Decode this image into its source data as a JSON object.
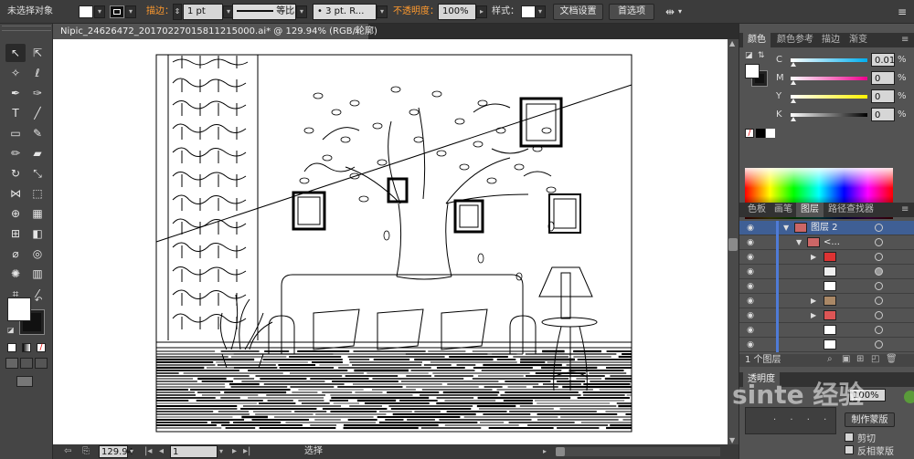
{
  "control_bar": {
    "selection_status": "未选择对象",
    "stroke_label": "描边：",
    "stroke_weight": "1 pt",
    "stroke_profile": "等比",
    "brush": "3 pt. R...",
    "opacity_label": "不透明度：",
    "opacity_value": "100%",
    "style_label": "样式：",
    "doc_setup_button": "文档设置",
    "preferences_button": "首选项"
  },
  "document_tab": {
    "title": "Nipic_24626472_20170227015811215000.ai* @ 129.94% (RGB/轮廓)",
    "close": "×"
  },
  "status_bar": {
    "zoom": "129.94",
    "page": "1",
    "tool_status": "选择"
  },
  "color_panel": {
    "tabs": [
      "颜色",
      "颜色参考",
      "描边",
      "渐变"
    ],
    "channels": [
      {
        "name": "C",
        "value": "0.01",
        "color": "#00aeef"
      },
      {
        "name": "M",
        "value": "0",
        "color": "#ec008c"
      },
      {
        "name": "Y",
        "value": "0",
        "color": "#fff200"
      },
      {
        "name": "K",
        "value": "0",
        "color": "#000000"
      }
    ],
    "percent_sign": "%"
  },
  "layers_panel": {
    "tabs": [
      "色板",
      "画笔",
      "图层",
      "路径查找器"
    ],
    "active_tab": "图层",
    "rows": [
      {
        "name": "图层 2",
        "indent": 0,
        "expanded": true
      },
      {
        "name": "<...",
        "indent": 1,
        "expanded": true
      },
      {
        "name": "",
        "indent": 2,
        "expanded": false
      },
      {
        "name": "",
        "indent": 2,
        "expanded": false
      },
      {
        "name": "",
        "indent": 2,
        "expanded": false
      },
      {
        "name": "",
        "indent": 2,
        "expanded": false
      },
      {
        "name": "",
        "indent": 2,
        "expanded": false
      },
      {
        "name": "",
        "indent": 2,
        "expanded": false
      },
      {
        "name": "",
        "indent": 2,
        "expanded": false
      }
    ],
    "footer_count": "1 个图层"
  },
  "transparency_panel": {
    "tab": "透明度",
    "opacity": "100%",
    "make_mask_button": "制作蒙版",
    "clip_label": "剪切",
    "invert_label": "反相蒙版"
  },
  "watermark": {
    "text": "sinte 经验"
  },
  "colors": {
    "accent_orange": "#ff9a2e",
    "selection_blue": "#4f7bd6"
  }
}
